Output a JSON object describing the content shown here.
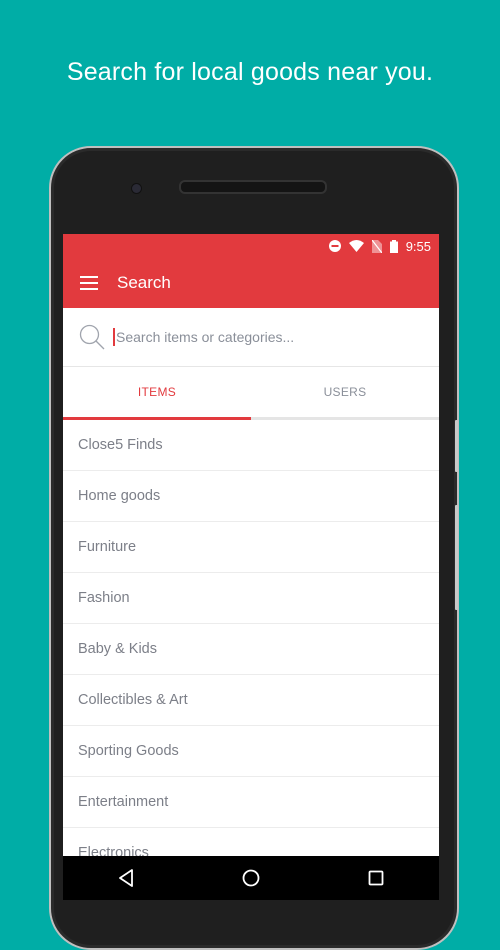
{
  "headline": "Search for local goods near you.",
  "status_bar": {
    "time": "9:55",
    "icons": [
      "do-not-disturb-icon",
      "wifi-icon",
      "no-sim-icon",
      "battery-icon"
    ]
  },
  "app_bar": {
    "title": "Search",
    "menu_icon": "hamburger-menu-icon"
  },
  "search": {
    "placeholder": "Search items or categories...",
    "value": ""
  },
  "tabs": [
    {
      "label": "ITEMS",
      "active": true
    },
    {
      "label": "USERS",
      "active": false
    }
  ],
  "categories": [
    "Close5 Finds",
    "Home goods",
    "Furniture",
    "Fashion",
    "Baby & Kids",
    "Collectibles & Art",
    "Sporting Goods",
    "Entertainment",
    "Electronics"
  ],
  "nav_bar": {
    "icons": [
      "back-icon",
      "home-icon",
      "recents-icon"
    ]
  },
  "colors": {
    "background": "#00ada6",
    "accent": "#e23a3e",
    "text_secondary": "#7c7f88"
  }
}
